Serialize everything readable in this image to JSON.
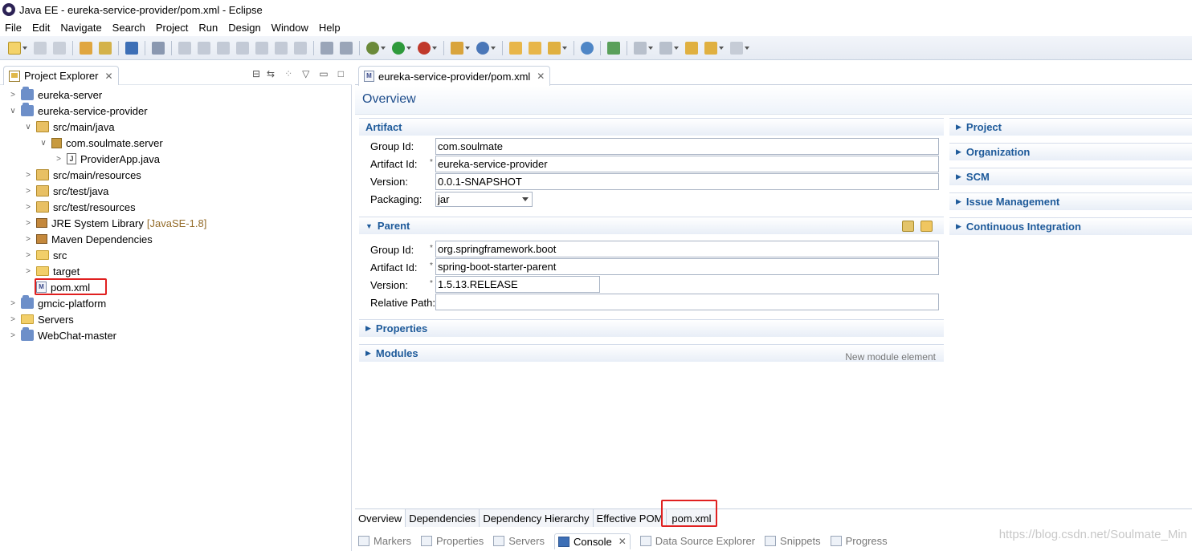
{
  "window": {
    "title": "Java EE - eureka-service-provider/pom.xml - Eclipse"
  },
  "menu": [
    "File",
    "Edit",
    "Navigate",
    "Search",
    "Project",
    "Run",
    "Design",
    "Window",
    "Help"
  ],
  "explorer": {
    "tab_label": "Project Explorer",
    "tree": [
      {
        "label": "eureka-server",
        "suffix": "",
        "icon": "project-icon",
        "expanded": false
      },
      {
        "label": "eureka-service-provider",
        "suffix": "",
        "icon": "project-icon",
        "expanded": true
      },
      {
        "label": "src/main/java",
        "suffix": "",
        "icon": "source-folder-icon",
        "expanded": true
      },
      {
        "label": "com.soulmate.server",
        "suffix": "",
        "icon": "package-icon",
        "expanded": true
      },
      {
        "label": "ProviderApp.java",
        "suffix": "",
        "icon": "java-file-icon",
        "expanded": false
      },
      {
        "label": "src/main/resources",
        "suffix": "",
        "icon": "source-folder-icon",
        "expanded": false
      },
      {
        "label": "src/test/java",
        "suffix": "",
        "icon": "source-folder-icon",
        "expanded": false
      },
      {
        "label": "src/test/resources",
        "suffix": "",
        "icon": "source-folder-icon",
        "expanded": false
      },
      {
        "label": "JRE System Library",
        "suffix": "[JavaSE-1.8]",
        "icon": "library-icon",
        "expanded": false
      },
      {
        "label": "Maven Dependencies",
        "suffix": "",
        "icon": "library-icon",
        "expanded": false
      },
      {
        "label": "src",
        "suffix": "",
        "icon": "folder-icon",
        "expanded": false
      },
      {
        "label": "target",
        "suffix": "",
        "icon": "folder-icon",
        "expanded": false
      },
      {
        "label": "pom.xml",
        "suffix": "",
        "icon": "xml-file-icon",
        "expanded": false
      },
      {
        "label": "gmcic-platform",
        "suffix": "",
        "icon": "project-icon",
        "expanded": false
      },
      {
        "label": "Servers",
        "suffix": "",
        "icon": "folder-icon",
        "expanded": false
      },
      {
        "label": "WebChat-master",
        "suffix": "",
        "icon": "project-icon",
        "expanded": false
      }
    ]
  },
  "editor": {
    "tab_label": "eureka-service-provider/pom.xml",
    "page_title": "Overview",
    "artifact": {
      "title": "Artifact",
      "group_id_label": "Group Id:",
      "group_id": "com.soulmate",
      "artifact_id_label": "Artifact Id:",
      "artifact_id": "eureka-service-provider",
      "version_label": "Version:",
      "version": "0.0.1-SNAPSHOT",
      "packaging_label": "Packaging:",
      "packaging": "jar"
    },
    "parent": {
      "title": "Parent",
      "group_id_label": "Group Id:",
      "group_id": "org.springframework.boot",
      "artifact_id_label": "Artifact Id:",
      "artifact_id": "spring-boot-starter-parent",
      "version_label": "Version:",
      "version": "1.5.13.RELEASE",
      "relative_path_label": "Relative Path:",
      "relative_path": ""
    },
    "properties_title": "Properties",
    "modules_title": "Modules",
    "modules_hint": "New module element",
    "right_sections": [
      "Project",
      "Organization",
      "SCM",
      "Issue Management",
      "Continuous Integration"
    ],
    "page_tabs": [
      "Overview",
      "Dependencies",
      "Dependency Hierarchy",
      "Effective POM",
      "pom.xml"
    ]
  },
  "views": [
    "Markers",
    "Properties",
    "Servers",
    "Console",
    "Data Source Explorer",
    "Snippets",
    "Progress"
  ],
  "watermark": "https://blog.csdn.net/Soulmate_Min"
}
